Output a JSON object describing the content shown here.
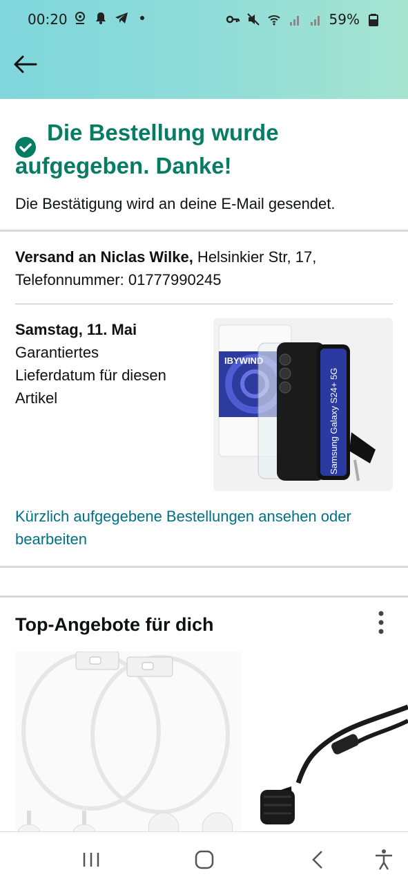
{
  "status": {
    "time": "00:20",
    "battery": "59%"
  },
  "confirmation": {
    "title_line1": "Die Bestellung wurde",
    "title_line2": "aufgegeben. Danke!",
    "subtitle": "Die Bestätigung wird an deine E-Mail gesendet."
  },
  "shipping": {
    "prefix": "Versand an Niclas Wilke,",
    "address": " Helsinkier Str, 17,",
    "phone": "Telefonnummer: 01777990245"
  },
  "delivery": {
    "date": "Samstag, 11. Mai",
    "line1": "Garantiertes",
    "line2": "Lieferdatum für diesen",
    "line3": "Artikel"
  },
  "product": {
    "brand": "IBYWIND",
    "phone_text": "Samsung Galaxy S24+ 5G"
  },
  "links": {
    "recent_orders": "Kürzlich aufgegebene Bestellungen ansehen oder bearbeiten"
  },
  "offers": {
    "title": "Top-Angebote für dich"
  },
  "colors": {
    "accent": "#067d62",
    "link": "#007185"
  }
}
